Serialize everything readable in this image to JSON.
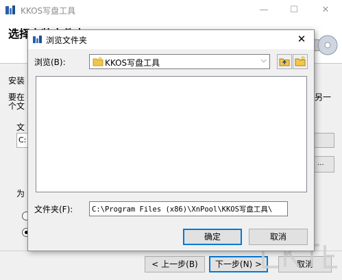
{
  "window": {
    "title": "KKOS写盘工具",
    "heading": "选择安装文件夹",
    "bg_line_install": "安装",
    "bg_line_want1": "要在",
    "bg_line_want2": "个文",
    "bg_right": "另一",
    "bg_folder_label": "文",
    "bg_folder_value": "C:",
    "bg_for": "为",
    "buttons": {
      "back": "< 上一步(B)",
      "next": "下一步(N) >",
      "cancel": "取消"
    }
  },
  "dialog": {
    "title": "浏览文件夹",
    "browse_label": "浏览(B):",
    "browse_value": "KKOS写盘工具",
    "folder_label": "文件夹(F):",
    "folder_value": "C:\\Program Files (x86)\\XnPool\\KKOS写盘工具\\",
    "ok_label": "确定",
    "cancel_label": "取消"
  }
}
